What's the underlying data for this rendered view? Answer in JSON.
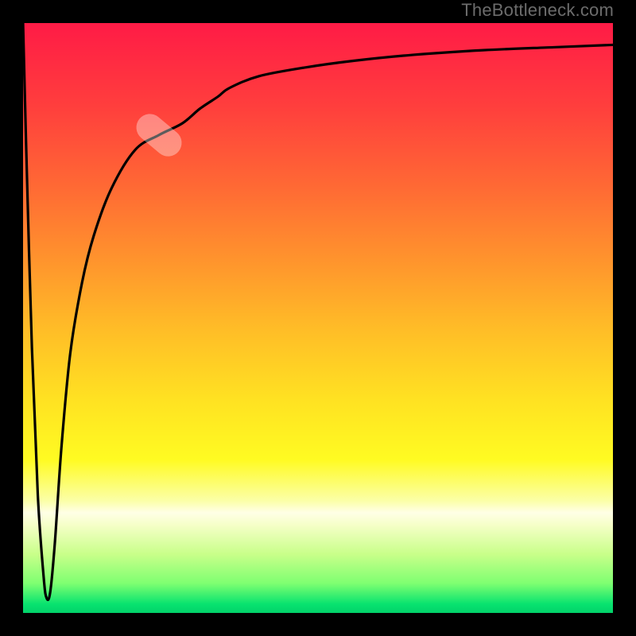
{
  "attribution": "TheBottleneck.com",
  "chart_data": {
    "type": "line",
    "title": "",
    "xlabel": "",
    "ylabel": "",
    "xlim": [
      0,
      100
    ],
    "ylim": [
      0,
      100
    ],
    "grid": false,
    "legend": false,
    "background_gradient": {
      "stops": [
        {
          "pct": 0.0,
          "color": "#ff1b46"
        },
        {
          "pct": 0.14,
          "color": "#ff3e3d"
        },
        {
          "pct": 0.28,
          "color": "#ff6a34"
        },
        {
          "pct": 0.4,
          "color": "#ff932d"
        },
        {
          "pct": 0.52,
          "color": "#ffbd27"
        },
        {
          "pct": 0.64,
          "color": "#ffe222"
        },
        {
          "pct": 0.74,
          "color": "#fffb22"
        },
        {
          "pct": 0.81,
          "color": "#fbffa8"
        },
        {
          "pct": 0.83,
          "color": "#ffffe6"
        },
        {
          "pct": 0.85,
          "color": "#f6ffc9"
        },
        {
          "pct": 0.9,
          "color": "#c9ff8a"
        },
        {
          "pct": 0.95,
          "color": "#7eff71"
        },
        {
          "pct": 0.985,
          "color": "#08e36f"
        },
        {
          "pct": 1.0,
          "color": "#02d26a"
        }
      ]
    },
    "series": [
      {
        "name": "bottleneck-curve",
        "x": [
          0.0,
          0.5,
          1.5,
          2.5,
          3.5,
          4.0,
          4.6,
          5.4,
          6.5,
          8.0,
          10.0,
          12.0,
          15.0,
          19.0,
          23.0,
          27.0,
          30.0,
          33.0,
          35.0,
          40.0,
          48.0,
          56.0,
          66.0,
          78.0,
          90.0,
          100.0
        ],
        "y": [
          100.0,
          80.0,
          45.0,
          20.0,
          6.0,
          2.5,
          3.5,
          12.0,
          28.0,
          44.0,
          56.0,
          64.0,
          72.0,
          78.5,
          81.0,
          83.0,
          85.5,
          87.5,
          89.0,
          91.0,
          92.5,
          93.6,
          94.6,
          95.4,
          95.9,
          96.3
        ]
      }
    ],
    "annotation": {
      "type": "pill",
      "center_x": 23,
      "center_y": 81,
      "angle_deg": -50,
      "color_rgba": "rgba(255,255,255,0.36)"
    }
  }
}
